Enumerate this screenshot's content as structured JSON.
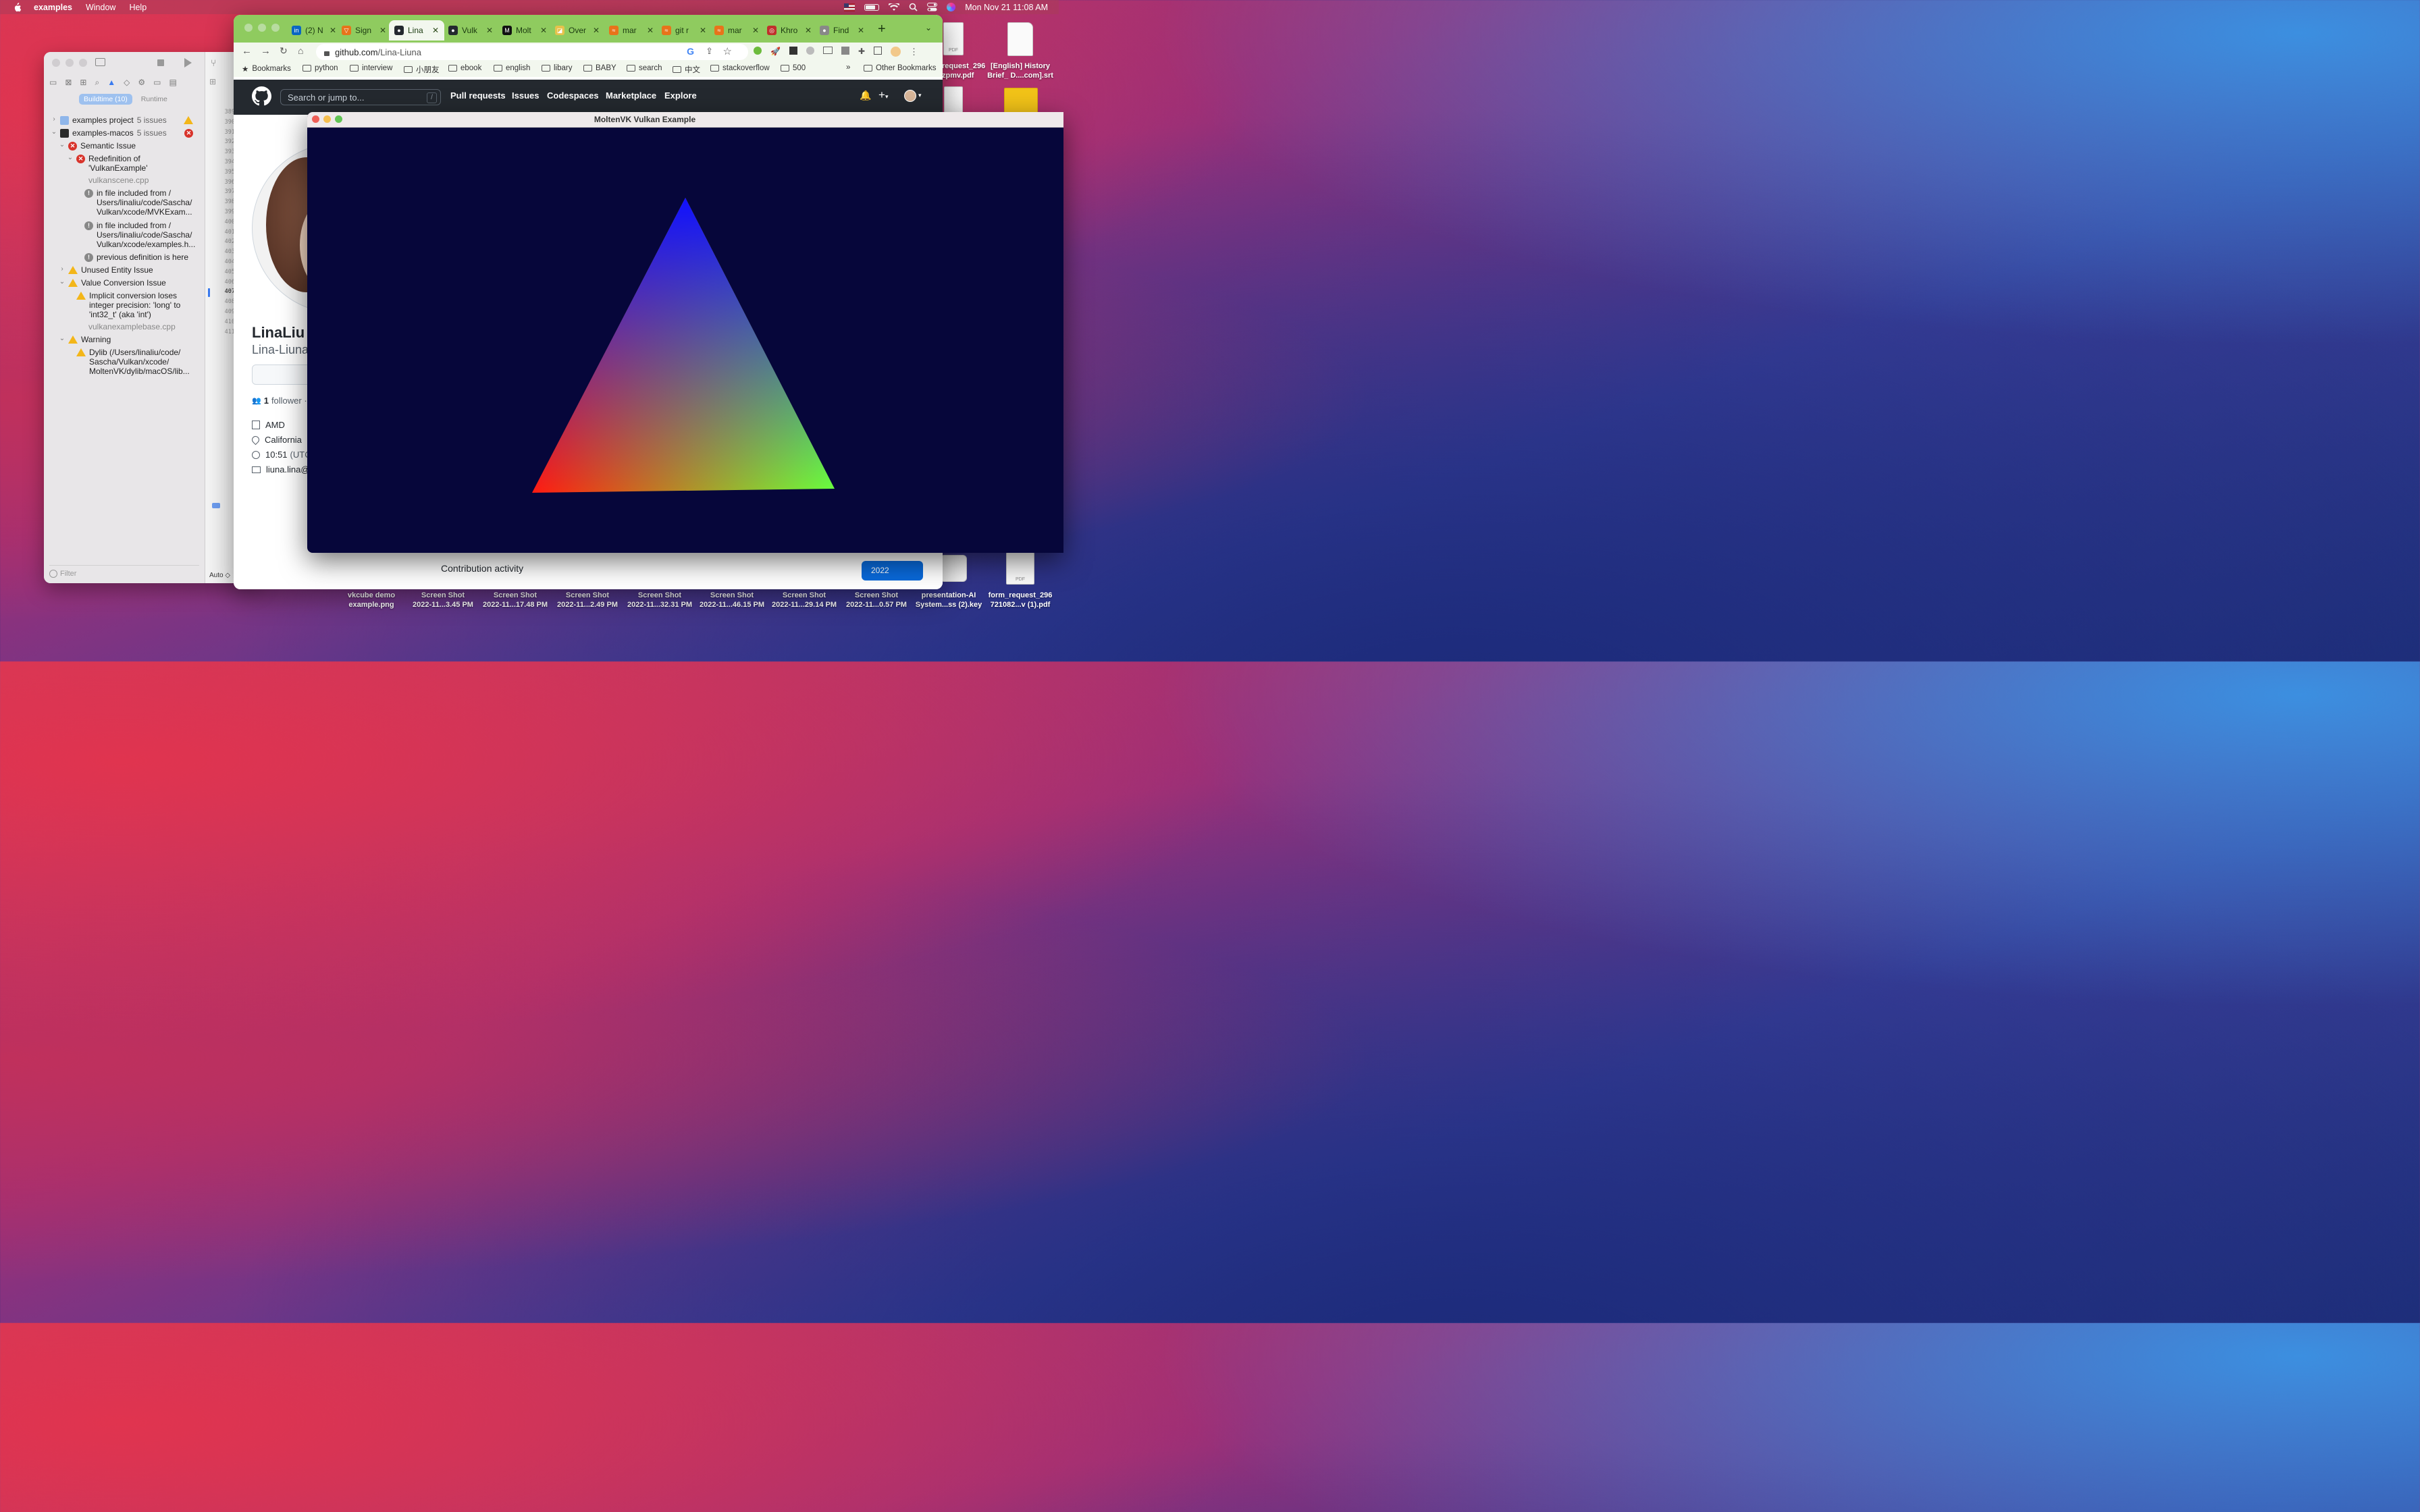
{
  "menubar": {
    "app_name": "examples",
    "items": [
      "Window",
      "Help"
    ],
    "datetime": "Mon Nov 21  11:08 AM"
  },
  "desktop": {
    "icons": [
      {
        "line1": "vkcube demo",
        "line2": "example.png"
      },
      {
        "line1": "Screen Shot",
        "line2": "2022-11...3.45 PM"
      },
      {
        "line1": "Screen Shot",
        "line2": "2022-11...17.48 PM"
      },
      {
        "line1": "Screen Shot",
        "line2": "2022-11...2.49 PM"
      },
      {
        "line1": "Screen Shot",
        "line2": "2022-11...32.31 PM"
      },
      {
        "line1": "Screen Shot",
        "line2": "2022-11...46.15 PM"
      },
      {
        "line1": "Screen Shot",
        "line2": "2022-11...29.14 PM"
      },
      {
        "line1": "Screen Shot",
        "line2": "2022-11...0.57 PM"
      },
      {
        "line1": "presentation-AI",
        "line2": "System...ss (2).key"
      },
      {
        "line1": "form_request_296",
        "line2": "721082...v (1).pdf"
      }
    ],
    "top_right": [
      {
        "line1": "request_296",
        "line2": "zpmv.pdf"
      },
      {
        "line1": "[English] History",
        "line2": "Brief_ D....com].srt"
      }
    ],
    "pdf_label": "PDF"
  },
  "xcode": {
    "segments": {
      "buildtime": "Buildtime (10)",
      "runtime": "Runtime"
    },
    "issues": {
      "project": {
        "name": "examples project",
        "count": "5 issues"
      },
      "macos": {
        "name": "examples-macos",
        "count": "5 issues"
      },
      "semantic": "Semantic Issue",
      "redef": "Redefinition of 'VulkanExample'",
      "redef_file": "vulkanscene.cpp",
      "note1": "in file included from / Users/linaliu/code/Sascha/ Vulkan/xcode/MVKExam...",
      "note2": "in file included from / Users/linaliu/code/Sascha/ Vulkan/xcode/examples.h...",
      "note3": "previous definition is here",
      "unused": "Unused Entity Issue",
      "valueconv": "Value Conversion Issue",
      "implicit": "Implicit conversion loses integer precision: 'long' to 'int32_t' (aka 'int')",
      "implicit_file": "vulkanexamplebase.cpp",
      "warning": "Warning",
      "dylib": "Dylib (/Users/linaliu/code/ Sascha/Vulkan/xcode/ MoltenVK/dylib/macOS/lib..."
    },
    "filter_placeholder": "Filter",
    "line_numbers": [
      "389",
      "390",
      "391",
      "392",
      "393",
      "394",
      "395",
      "396",
      "397",
      "398",
      "399",
      "400",
      "401",
      "402",
      "403",
      "404",
      "405",
      "406",
      "407",
      "408",
      "409",
      "410",
      "411"
    ],
    "editor_footer": "Auto ◇"
  },
  "chrome": {
    "tabs": [
      {
        "label": "(2) N",
        "color": "#0a66c2",
        "glyph": "in"
      },
      {
        "label": "Sign",
        "color": "#e8731a",
        "glyph": "▽"
      },
      {
        "label": "Lina",
        "color": "#24292f",
        "glyph": "●"
      },
      {
        "label": "Vulk",
        "color": "#24292f",
        "glyph": "●"
      },
      {
        "label": "Molt",
        "color": "#111111",
        "glyph": "M"
      },
      {
        "label": "Over",
        "color": "#e6c24c",
        "glyph": "◪"
      },
      {
        "label": "mar",
        "color": "#e8731a",
        "glyph": "≈"
      },
      {
        "label": "git r",
        "color": "#e8731a",
        "glyph": "≈"
      },
      {
        "label": "mar",
        "color": "#e8731a",
        "glyph": "≈"
      },
      {
        "label": "Khro",
        "color": "#c0302b",
        "glyph": "◎"
      },
      {
        "label": "Find",
        "color": "#888888",
        "glyph": "●"
      }
    ],
    "url_domain": "github.com",
    "url_path": "/Lina-Liuna",
    "bookmarks_label": "Bookmarks",
    "bookmark_folders": [
      "python",
      "interview",
      "小朋友",
      "ebook",
      "english",
      "libary",
      "BABY",
      "search",
      "中文",
      "stackoverflow",
      "500"
    ],
    "more": "»",
    "other_bookmarks": "Other Bookmarks"
  },
  "github": {
    "search_placeholder": "Search or jump to...",
    "search_key": "/",
    "nav": [
      "Pull requests",
      "Issues",
      "Codespaces",
      "Marketplace",
      "Explore"
    ],
    "name": "LinaLiu",
    "login": "Lina-Liuna",
    "followers_count": "1",
    "followers_label": "follower ·",
    "company": "AMD",
    "location": "California",
    "time": "10:51",
    "time_suffix": "(UTC",
    "email": "liuna.lina@",
    "contribution": "Contribution activity",
    "year": "2022"
  },
  "vulkan": {
    "title": "MoltenVK Vulkan Example",
    "colors": {
      "top": "#1010ff",
      "left": "#ff1a12",
      "right": "#6aff3c",
      "bg": "#06063a"
    }
  }
}
